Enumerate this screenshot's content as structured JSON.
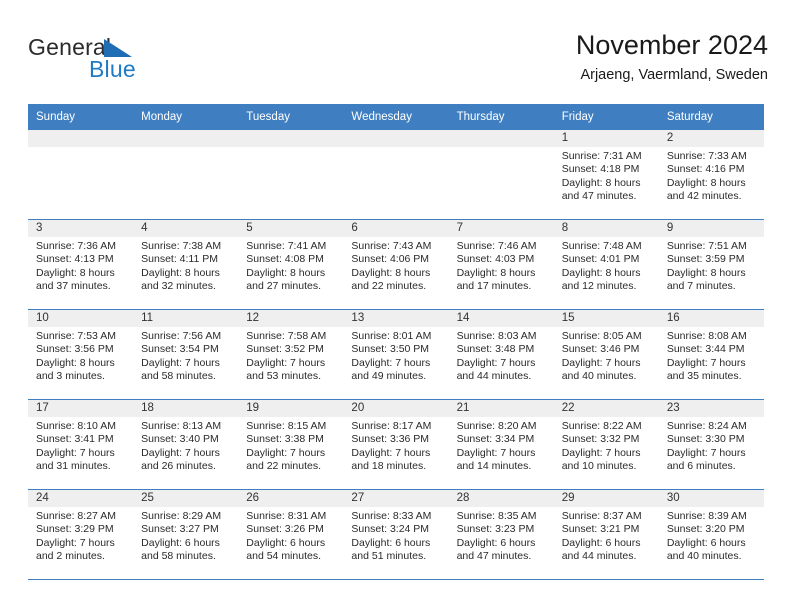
{
  "brand": {
    "name_part1": "General",
    "name_part2": "Blue",
    "triangle_color": "#1f6eb5",
    "blue_color": "#1f7bc4"
  },
  "header": {
    "title": "November 2024",
    "subtitle": "Arjaeng, Vaermland, Sweden"
  },
  "theme": {
    "header_blue": "#3f7fc1",
    "day_strip_gray": "#efefef"
  },
  "weekdays": [
    "Sunday",
    "Monday",
    "Tuesday",
    "Wednesday",
    "Thursday",
    "Friday",
    "Saturday"
  ],
  "weeks": [
    [
      {
        "day": "",
        "sunrise": "",
        "sunset": "",
        "daylight_line1": "",
        "daylight_line2": ""
      },
      {
        "day": "",
        "sunrise": "",
        "sunset": "",
        "daylight_line1": "",
        "daylight_line2": ""
      },
      {
        "day": "",
        "sunrise": "",
        "sunset": "",
        "daylight_line1": "",
        "daylight_line2": ""
      },
      {
        "day": "",
        "sunrise": "",
        "sunset": "",
        "daylight_line1": "",
        "daylight_line2": ""
      },
      {
        "day": "",
        "sunrise": "",
        "sunset": "",
        "daylight_line1": "",
        "daylight_line2": ""
      },
      {
        "day": "1",
        "sunrise": "Sunrise: 7:31 AM",
        "sunset": "Sunset: 4:18 PM",
        "daylight_line1": "Daylight: 8 hours",
        "daylight_line2": "and 47 minutes."
      },
      {
        "day": "2",
        "sunrise": "Sunrise: 7:33 AM",
        "sunset": "Sunset: 4:16 PM",
        "daylight_line1": "Daylight: 8 hours",
        "daylight_line2": "and 42 minutes."
      }
    ],
    [
      {
        "day": "3",
        "sunrise": "Sunrise: 7:36 AM",
        "sunset": "Sunset: 4:13 PM",
        "daylight_line1": "Daylight: 8 hours",
        "daylight_line2": "and 37 minutes."
      },
      {
        "day": "4",
        "sunrise": "Sunrise: 7:38 AM",
        "sunset": "Sunset: 4:11 PM",
        "daylight_line1": "Daylight: 8 hours",
        "daylight_line2": "and 32 minutes."
      },
      {
        "day": "5",
        "sunrise": "Sunrise: 7:41 AM",
        "sunset": "Sunset: 4:08 PM",
        "daylight_line1": "Daylight: 8 hours",
        "daylight_line2": "and 27 minutes."
      },
      {
        "day": "6",
        "sunrise": "Sunrise: 7:43 AM",
        "sunset": "Sunset: 4:06 PM",
        "daylight_line1": "Daylight: 8 hours",
        "daylight_line2": "and 22 minutes."
      },
      {
        "day": "7",
        "sunrise": "Sunrise: 7:46 AM",
        "sunset": "Sunset: 4:03 PM",
        "daylight_line1": "Daylight: 8 hours",
        "daylight_line2": "and 17 minutes."
      },
      {
        "day": "8",
        "sunrise": "Sunrise: 7:48 AM",
        "sunset": "Sunset: 4:01 PM",
        "daylight_line1": "Daylight: 8 hours",
        "daylight_line2": "and 12 minutes."
      },
      {
        "day": "9",
        "sunrise": "Sunrise: 7:51 AM",
        "sunset": "Sunset: 3:59 PM",
        "daylight_line1": "Daylight: 8 hours",
        "daylight_line2": "and 7 minutes."
      }
    ],
    [
      {
        "day": "10",
        "sunrise": "Sunrise: 7:53 AM",
        "sunset": "Sunset: 3:56 PM",
        "daylight_line1": "Daylight: 8 hours",
        "daylight_line2": "and 3 minutes."
      },
      {
        "day": "11",
        "sunrise": "Sunrise: 7:56 AM",
        "sunset": "Sunset: 3:54 PM",
        "daylight_line1": "Daylight: 7 hours",
        "daylight_line2": "and 58 minutes."
      },
      {
        "day": "12",
        "sunrise": "Sunrise: 7:58 AM",
        "sunset": "Sunset: 3:52 PM",
        "daylight_line1": "Daylight: 7 hours",
        "daylight_line2": "and 53 minutes."
      },
      {
        "day": "13",
        "sunrise": "Sunrise: 8:01 AM",
        "sunset": "Sunset: 3:50 PM",
        "daylight_line1": "Daylight: 7 hours",
        "daylight_line2": "and 49 minutes."
      },
      {
        "day": "14",
        "sunrise": "Sunrise: 8:03 AM",
        "sunset": "Sunset: 3:48 PM",
        "daylight_line1": "Daylight: 7 hours",
        "daylight_line2": "and 44 minutes."
      },
      {
        "day": "15",
        "sunrise": "Sunrise: 8:05 AM",
        "sunset": "Sunset: 3:46 PM",
        "daylight_line1": "Daylight: 7 hours",
        "daylight_line2": "and 40 minutes."
      },
      {
        "day": "16",
        "sunrise": "Sunrise: 8:08 AM",
        "sunset": "Sunset: 3:44 PM",
        "daylight_line1": "Daylight: 7 hours",
        "daylight_line2": "and 35 minutes."
      }
    ],
    [
      {
        "day": "17",
        "sunrise": "Sunrise: 8:10 AM",
        "sunset": "Sunset: 3:41 PM",
        "daylight_line1": "Daylight: 7 hours",
        "daylight_line2": "and 31 minutes."
      },
      {
        "day": "18",
        "sunrise": "Sunrise: 8:13 AM",
        "sunset": "Sunset: 3:40 PM",
        "daylight_line1": "Daylight: 7 hours",
        "daylight_line2": "and 26 minutes."
      },
      {
        "day": "19",
        "sunrise": "Sunrise: 8:15 AM",
        "sunset": "Sunset: 3:38 PM",
        "daylight_line1": "Daylight: 7 hours",
        "daylight_line2": "and 22 minutes."
      },
      {
        "day": "20",
        "sunrise": "Sunrise: 8:17 AM",
        "sunset": "Sunset: 3:36 PM",
        "daylight_line1": "Daylight: 7 hours",
        "daylight_line2": "and 18 minutes."
      },
      {
        "day": "21",
        "sunrise": "Sunrise: 8:20 AM",
        "sunset": "Sunset: 3:34 PM",
        "daylight_line1": "Daylight: 7 hours",
        "daylight_line2": "and 14 minutes."
      },
      {
        "day": "22",
        "sunrise": "Sunrise: 8:22 AM",
        "sunset": "Sunset: 3:32 PM",
        "daylight_line1": "Daylight: 7 hours",
        "daylight_line2": "and 10 minutes."
      },
      {
        "day": "23",
        "sunrise": "Sunrise: 8:24 AM",
        "sunset": "Sunset: 3:30 PM",
        "daylight_line1": "Daylight: 7 hours",
        "daylight_line2": "and 6 minutes."
      }
    ],
    [
      {
        "day": "24",
        "sunrise": "Sunrise: 8:27 AM",
        "sunset": "Sunset: 3:29 PM",
        "daylight_line1": "Daylight: 7 hours",
        "daylight_line2": "and 2 minutes."
      },
      {
        "day": "25",
        "sunrise": "Sunrise: 8:29 AM",
        "sunset": "Sunset: 3:27 PM",
        "daylight_line1": "Daylight: 6 hours",
        "daylight_line2": "and 58 minutes."
      },
      {
        "day": "26",
        "sunrise": "Sunrise: 8:31 AM",
        "sunset": "Sunset: 3:26 PM",
        "daylight_line1": "Daylight: 6 hours",
        "daylight_line2": "and 54 minutes."
      },
      {
        "day": "27",
        "sunrise": "Sunrise: 8:33 AM",
        "sunset": "Sunset: 3:24 PM",
        "daylight_line1": "Daylight: 6 hours",
        "daylight_line2": "and 51 minutes."
      },
      {
        "day": "28",
        "sunrise": "Sunrise: 8:35 AM",
        "sunset": "Sunset: 3:23 PM",
        "daylight_line1": "Daylight: 6 hours",
        "daylight_line2": "and 47 minutes."
      },
      {
        "day": "29",
        "sunrise": "Sunrise: 8:37 AM",
        "sunset": "Sunset: 3:21 PM",
        "daylight_line1": "Daylight: 6 hours",
        "daylight_line2": "and 44 minutes."
      },
      {
        "day": "30",
        "sunrise": "Sunrise: 8:39 AM",
        "sunset": "Sunset: 3:20 PM",
        "daylight_line1": "Daylight: 6 hours",
        "daylight_line2": "and 40 minutes."
      }
    ]
  ]
}
